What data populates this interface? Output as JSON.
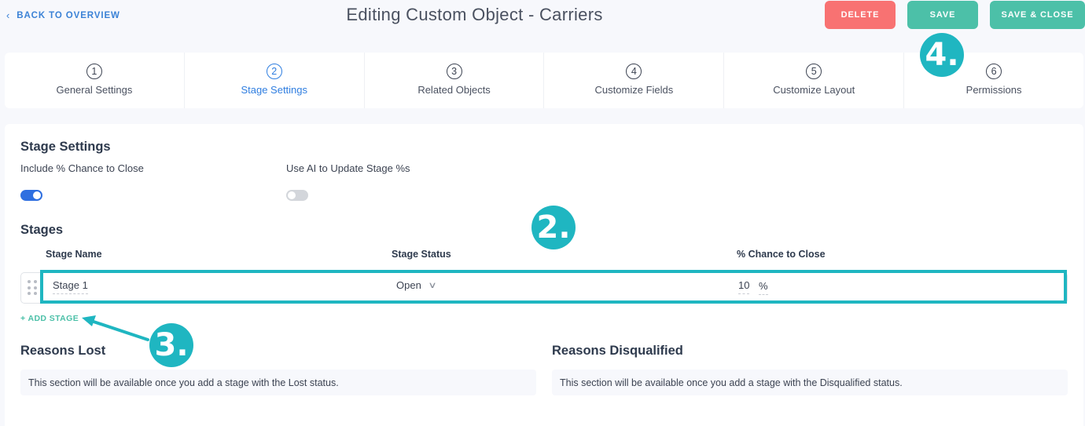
{
  "header": {
    "back_label": "BACK TO OVERVIEW",
    "back_icon": "chevron-left-icon",
    "title": "Editing Custom Object - Carriers",
    "delete_label": "DELETE",
    "save_label": "SAVE",
    "save_close_label": "SAVE & CLOSE",
    "colors": {
      "delete": "#f87272",
      "save": "#4cc0a8",
      "accent": "#2f7ee0",
      "annotation": "#1fb6c1"
    }
  },
  "steps": [
    {
      "num": "1",
      "label": "General Settings",
      "active": false
    },
    {
      "num": "2",
      "label": "Stage Settings",
      "active": true
    },
    {
      "num": "3",
      "label": "Related Objects",
      "active": false
    },
    {
      "num": "4",
      "label": "Customize Fields",
      "active": false
    },
    {
      "num": "5",
      "label": "Customize Layout",
      "active": false
    },
    {
      "num": "6",
      "label": "Permissions",
      "active": false
    }
  ],
  "stage_settings": {
    "title": "Stage Settings",
    "include_chance_label": "Include % Chance to Close",
    "include_chance_on": true,
    "use_ai_label": "Use AI to Update Stage %s",
    "use_ai_on": false
  },
  "stages": {
    "title": "Stages",
    "columns": [
      "Stage Name",
      "Stage Status",
      "% Chance to Close"
    ],
    "rows": [
      {
        "name": "Stage 1",
        "status": "Open",
        "chance": "10",
        "pct_sign": "%"
      }
    ],
    "add_label": "+ ADD STAGE"
  },
  "reasons_lost": {
    "title": "Reasons Lost",
    "message": "This section will be available once you add a stage with the Lost status."
  },
  "reasons_disqualified": {
    "title": "Reasons Disqualified",
    "message": "This section will be available once you add a stage with the Disqualified status."
  },
  "annotations": {
    "two": "2.",
    "three": "3.",
    "four": "4."
  }
}
